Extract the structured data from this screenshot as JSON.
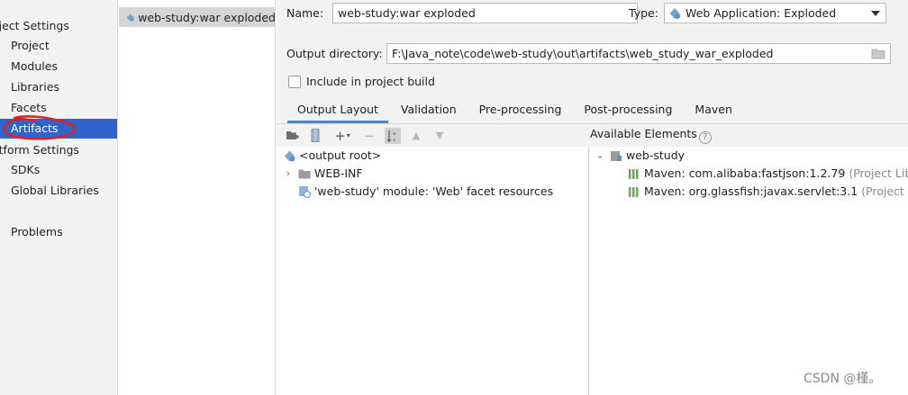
{
  "sidebar": {
    "project_settings_header": "oject Settings",
    "items_project": [
      "Project",
      "Modules",
      "Libraries",
      "Facets",
      "Artifacts"
    ],
    "platform_settings_header": "atform Settings",
    "items_platform": [
      "SDKs",
      "Global Libraries"
    ],
    "problems": "Problems",
    "selected": "Artifacts"
  },
  "artifacts_list": {
    "items": [
      "web-study:war exploded"
    ]
  },
  "form": {
    "name_label": "Name:",
    "name_value": "web-study:war exploded",
    "type_label": "Type:",
    "type_value": "Web Application: Exploded",
    "output_dir_label": "Output directory:",
    "output_dir_value": "F:\\Java_note\\code\\web-study\\out\\artifacts\\web_study_war_exploded",
    "include_label": "Include in project build",
    "include_checked": false
  },
  "tabs": [
    "Output Layout",
    "Validation",
    "Pre-processing",
    "Post-processing",
    "Maven"
  ],
  "active_tab": "Output Layout",
  "available_elements_label": "Available Elements",
  "output_tree": [
    {
      "label": "<output root>",
      "icon": "artifact-icon"
    },
    {
      "label": "WEB-INF",
      "icon": "folder-icon"
    },
    {
      "label": "'web-study' module: 'Web' facet resources",
      "icon": "web-facet-icon"
    }
  ],
  "available_tree": {
    "module": "web-study",
    "libraries": [
      {
        "name": "Maven: com.alibaba:fastjson:1.2.79",
        "scope": "(Project Library)"
      },
      {
        "name": "Maven: org.glassfish:javax.servlet:3.1",
        "scope": "(Project Library)"
      }
    ]
  },
  "watermark": "CSDN @槿。",
  "colors": {
    "selection": "#2f65ca",
    "annotation": "#e02020",
    "active_tab_underline": "#4a88c7"
  }
}
